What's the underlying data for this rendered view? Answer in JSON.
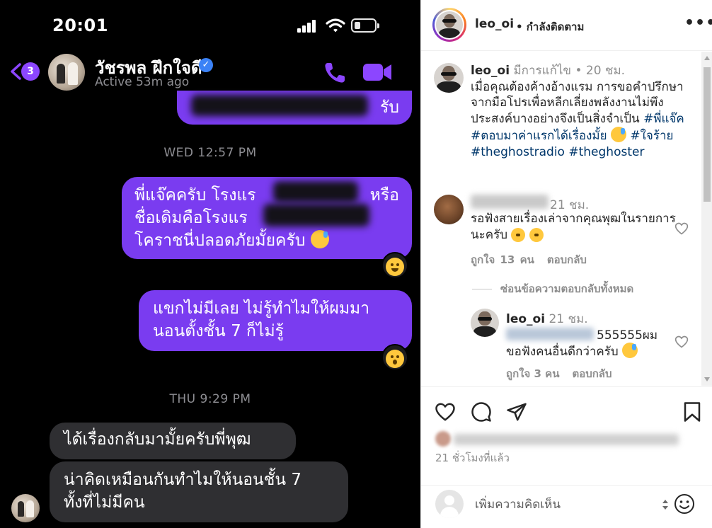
{
  "messenger": {
    "status_time": "20:01",
    "back_badge": "3",
    "contact_name": "วัชรพล ฝึกใจดี",
    "contact_status": "Active 53m ago",
    "top_bubble_tail": "รับ",
    "timestamp_wed": "WED 12:57 PM",
    "out_msg1_line1": "พี่แจ๊คครับ โรงแร",
    "out_msg1_line1_end": "หรือ",
    "out_msg1_line2": "ชื่อเดิมคือโรงแร",
    "out_msg1_line3": "โคราชนี่ปลอดภัยมั้ยครับ",
    "out_msg2_line1": "แขกไม่มีเลย ไม่รู้ทำไมให้ผมมา",
    "out_msg2_line2": "นอนตั้งชั้น 7 ก็ไม่รู้",
    "timestamp_thu": "THU 9:29 PM",
    "in_msg1": "ได้เรื่องกลับมามั้ยครับพี่พุฒ",
    "in_msg2_line1": "น่าคิดเหมือนกันทำไมให้นอนชั้น 7",
    "in_msg2_line2": "ทั้งที่ไม่มีคน",
    "accent_color": "#7a3cf0"
  },
  "instagram": {
    "username": "leo_oi",
    "follow_label": "• กำลังติดตาม",
    "more_label": "•••",
    "caption": {
      "username": "leo_oi",
      "meta": "มีการแก้ไข • 20 ชม.",
      "text": "เมื่อคุณต้องค้างอ้างแรม การขอคำปรึกษาจากมือโปรเพื่อหลีกเลี่ยงพลังงานไม่พึงประสงค์บางอย่างจึงเป็นสิ่งจำเป็น",
      "tag1": "#พี่แจ๊ค",
      "tag2": "#ตอบมาค่าแรกได้เรื่องมั้ย",
      "tag3": "#ใจร้าย",
      "tag4": "#theghostradio",
      "tag5": "#theghoster"
    },
    "comment1": {
      "time": "21 ชม.",
      "text": "รอฟังสายเรื่องเล่าจากคุณพุฒในรายการนะครับ",
      "likes": "ถูกใจ 13 คน",
      "reply": "ตอบกลับ"
    },
    "hide_replies": "ซ่อนข้อความตอบกลับทั้งหมด",
    "reply1": {
      "username": "leo_oi",
      "time": "21 ชม.",
      "text1": "555555ผม",
      "text2": "ขอฟังคนอื่นดีกว่าครับ",
      "likes": "ถูกใจ 3 คน",
      "reply": "ตอบกลับ"
    },
    "post_time": "21 ชั่วโมงที่แล้ว",
    "comment_placeholder": "เพิ่มความคิดเห็น"
  }
}
